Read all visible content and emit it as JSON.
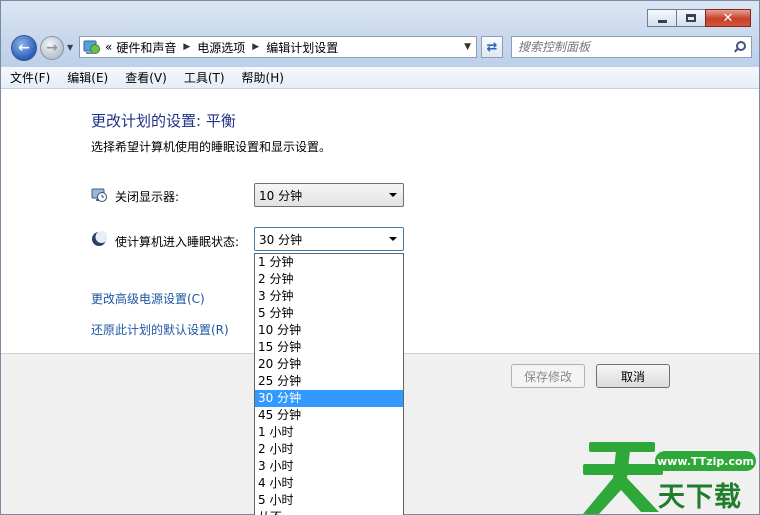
{
  "window": {
    "controls": {
      "minimize": "—",
      "maximize": "☐",
      "close": "✕"
    }
  },
  "address": {
    "overflow": "«",
    "crumbs": [
      "硬件和声音",
      "电源选项",
      "编辑计划设置"
    ]
  },
  "search": {
    "placeholder": "搜索控制面板"
  },
  "menu": [
    "文件(F)",
    "编辑(E)",
    "查看(V)",
    "工具(T)",
    "帮助(H)"
  ],
  "content": {
    "title": "更改计划的设置: 平衡",
    "subtitle": "选择希望计算机使用的睡眠设置和显示设置。",
    "display_off": {
      "label": "关闭显示器:",
      "value": "10 分钟",
      "icon": "monitor-clock-icon"
    },
    "sleep": {
      "label": "使计算机进入睡眠状态:",
      "value": "30 分钟",
      "icon": "moon-icon"
    },
    "links": {
      "advanced": "更改高级电源设置(C)",
      "restore": "还原此计划的默认设置(R)"
    }
  },
  "dropdown": {
    "options": [
      "1 分钟",
      "2 分钟",
      "3 分钟",
      "5 分钟",
      "10 分钟",
      "15 分钟",
      "20 分钟",
      "25 分钟",
      "30 分钟",
      "45 分钟",
      "1 小时",
      "2 小时",
      "3 小时",
      "4 小时",
      "5 小时",
      "从不"
    ],
    "selected": "30 分钟"
  },
  "buttons": {
    "save": "保存修改",
    "cancel": "取消"
  },
  "watermark": {
    "url": "www.TTzip.com",
    "name": "天下载"
  },
  "colors": {
    "title": "#1e3287",
    "link": "#1e57a3",
    "selection": "#3399ff",
    "watermark": "#2fa83a"
  }
}
